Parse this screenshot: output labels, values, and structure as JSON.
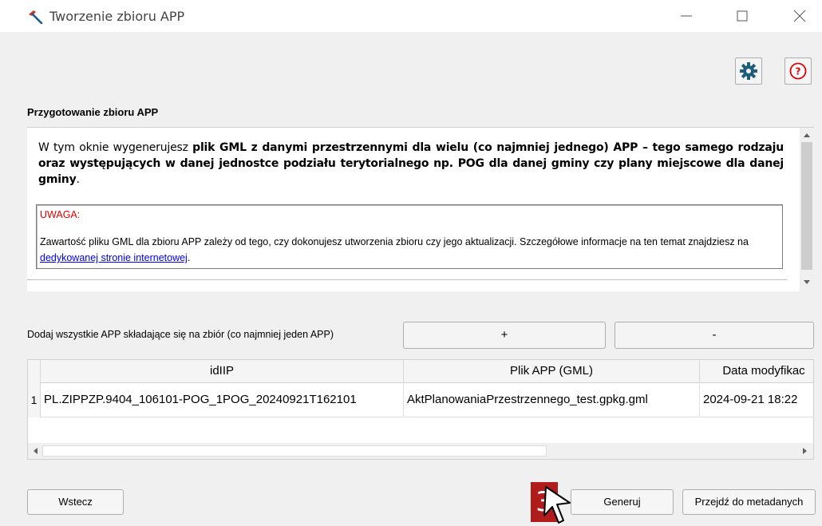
{
  "window": {
    "title": "Tworzenie zbioru APP",
    "minimize_icon": "minimize-icon",
    "maximize_icon": "maximize-icon",
    "close_icon": "close-icon",
    "app_icon": "hammer-icon"
  },
  "toolbar": {
    "settings_icon": "gear-icon",
    "help_icon": "help-icon",
    "settings_color": "#1f5d7a",
    "help_color": "#e00000"
  },
  "section": {
    "title": "Przygotowanie zbioru APP"
  },
  "info": {
    "intro_prefix": "W tym oknie wygenerujesz ",
    "intro_bold": "plik GML z danymi przestrzennymi dla wielu (co najmniej jednego) APP – tego samego rodzaju oraz występujących w danej jednostce podziału terytorialnego np. POG dla danej gminy czy plany miejscowe dla danej gminy",
    "intro_suffix": ".",
    "note_title": "UWAGA:",
    "note_text": "Zawartość pliku GML dla zbioru APP zależy od tego, czy dokonujesz utworzenia zbioru czy jego aktualizacji. Szczegółowe informacje na ten temat znajdziesz na ",
    "note_link": "dedykowanej stronie internetowej",
    "note_end": "."
  },
  "add_section": {
    "label": "Dodaj wszystkie APP składające się na zbiór (co najmniej jeden APP)",
    "add_button": "+",
    "remove_button": "-"
  },
  "table": {
    "columns": [
      "idIIP",
      "Plik APP (GML)",
      "Data modyfikac"
    ],
    "rows": [
      {
        "num": "1",
        "cells": [
          "PL.ZIPPZP.9404_106101-POG_1POG_20240921T162101",
          "AktPlanowaniaPrzestrzennego_test.gpkg.gml",
          "2024-09-21 18:22"
        ]
      }
    ]
  },
  "footer": {
    "back_button": "Wstecz",
    "generate_button": "Generuj",
    "metadata_button": "Przejdź do metadanych",
    "step_number": "3",
    "step_color": "#b01b1b"
  }
}
